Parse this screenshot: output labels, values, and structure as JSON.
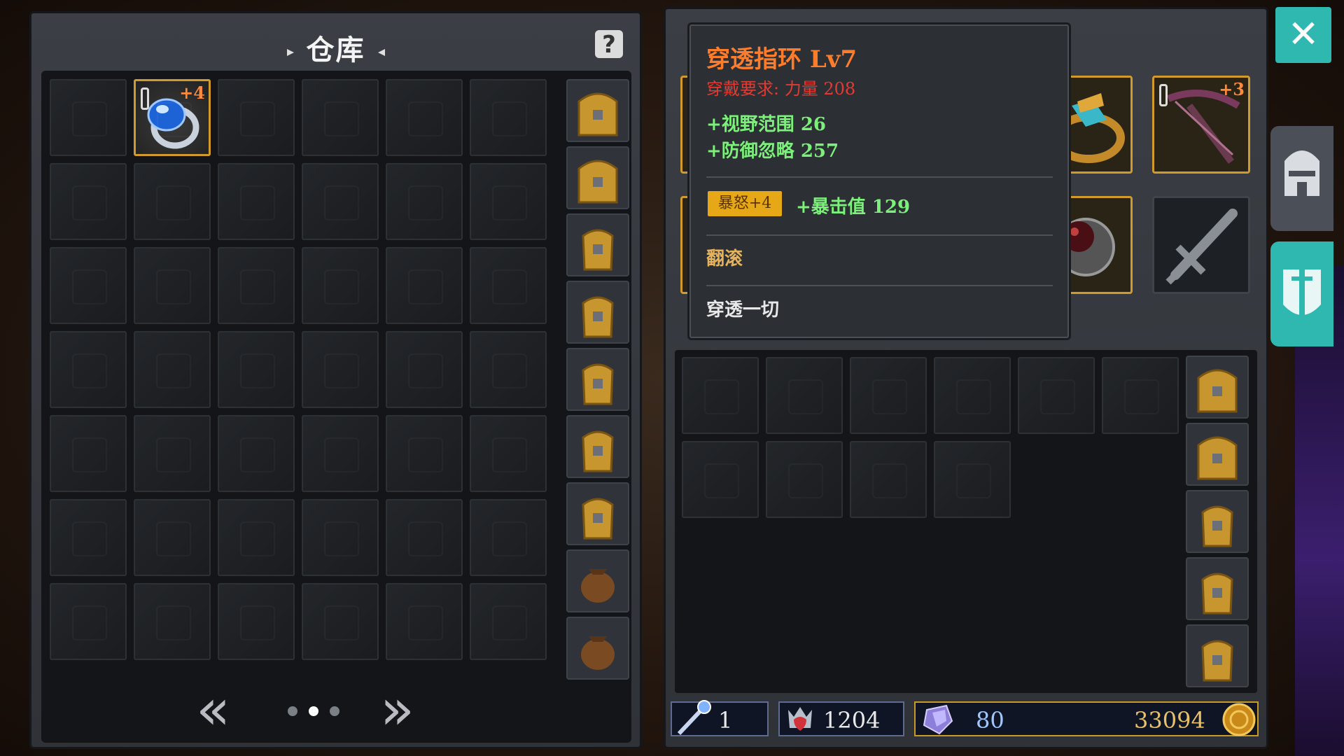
{
  "storage": {
    "title": "仓库",
    "help_label": "?",
    "selected_item": {
      "enhance": "+4",
      "name": "sapphire-ring"
    },
    "pager": {
      "prev": "«",
      "next": "»",
      "pages": 3,
      "current": 2
    }
  },
  "tooltip": {
    "name": "穿透指环 Lv7",
    "requirement": "穿戴要求:  力量 208",
    "stats": [
      "+视野范围 26",
      "+防御忽略 257"
    ],
    "badge": "暴怒+4",
    "crit_stat": "+暴击值 129",
    "skill": "翻滚",
    "description": "穿透一切"
  },
  "equipment": {
    "bow_enhance": "+3"
  },
  "resources": {
    "level_items": "1",
    "hearts": "1204",
    "gems": "80",
    "gold": "33094"
  },
  "close_label": "✕",
  "colors": {
    "accent": "#2fb8b0",
    "gold_border": "#d19a2d",
    "tooltip_name": "#ff7c2a",
    "stat_green": "#7cf07b"
  }
}
